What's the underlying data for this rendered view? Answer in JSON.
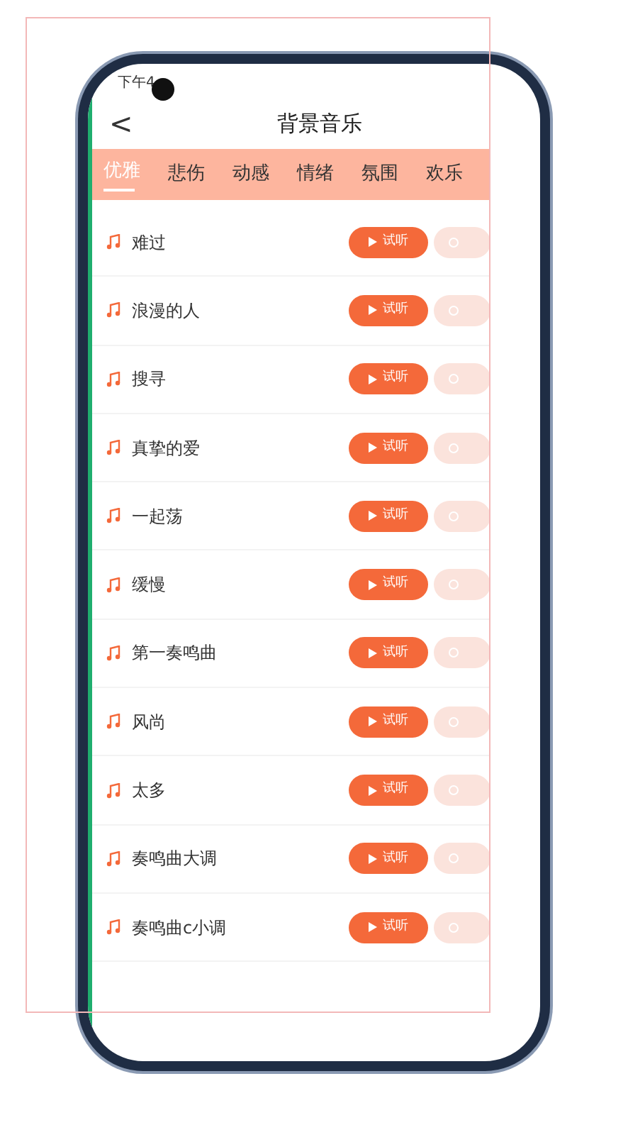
{
  "status_bar": {
    "time": "下午4"
  },
  "header": {
    "back": "<",
    "title": "背景音乐"
  },
  "tabs": [
    {
      "label": "优雅",
      "selected": true
    },
    {
      "label": "悲伤",
      "selected": false
    },
    {
      "label": "动感",
      "selected": false
    },
    {
      "label": "情绪",
      "selected": false
    },
    {
      "label": "氛围",
      "selected": false
    },
    {
      "label": "欢乐",
      "selected": false
    }
  ],
  "songs": [
    {
      "name": "难过",
      "preview": "试听"
    },
    {
      "name": "浪漫的人",
      "preview": "试听"
    },
    {
      "name": "搜寻",
      "preview": "试听"
    },
    {
      "name": "真挚的爱",
      "preview": "试听"
    },
    {
      "name": "一起荡",
      "preview": "试听"
    },
    {
      "name": "缓慢",
      "preview": "试听"
    },
    {
      "name": "第一奏鸣曲",
      "preview": "试听"
    },
    {
      "name": "风尚",
      "preview": "试听"
    },
    {
      "name": "太多",
      "preview": "试听"
    },
    {
      "name": "奏鸣曲大调",
      "preview": "试听"
    },
    {
      "name": "奏鸣曲c小调",
      "preview": "试听"
    }
  ]
}
